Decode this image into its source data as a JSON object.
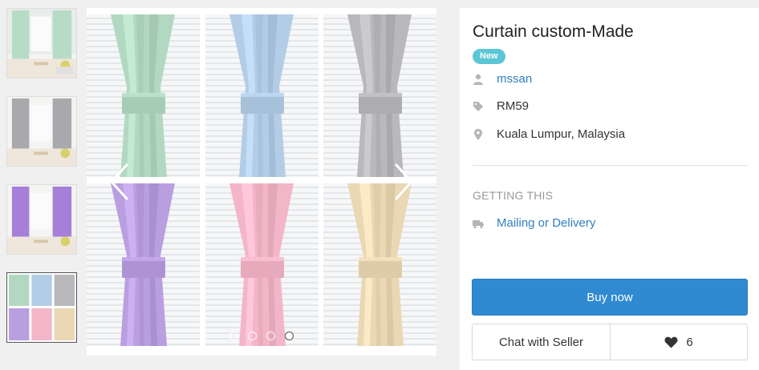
{
  "listing": {
    "title": "Curtain custom-Made",
    "badge": "New",
    "seller": "mssan",
    "price": "RM59",
    "location": "Kuala Lumpur, Malaysia"
  },
  "getting": {
    "heading": "GETTING THIS",
    "method": "Mailing or Delivery"
  },
  "actions": {
    "buy_label": "Buy now",
    "chat_label": "Chat with Seller",
    "like_count": "6"
  },
  "gallery": {
    "thumbnails": [
      "mint-curtain-room",
      "grey-curtain-room",
      "purple-curtain-room",
      "colour-swatch-grid"
    ],
    "active_thumbnail": 4,
    "slide_dots": 4,
    "active_dot": 4,
    "curtain_colors": {
      "mint": "#b3d8c2",
      "blue": "#b4cde6",
      "grey": "#b9b9bd",
      "lilac": "#b99fe0",
      "pink": "#f2b6c8",
      "beige": "#ead7b4"
    }
  },
  "colors": {
    "accent": "#2f8ad1",
    "link": "#2f7fc1",
    "badge": "#5cc6d6"
  },
  "icons": [
    "user-icon",
    "tag-icon",
    "location-pin-icon",
    "truck-icon",
    "heart-icon",
    "chevron-left-icon",
    "chevron-right-icon"
  ]
}
